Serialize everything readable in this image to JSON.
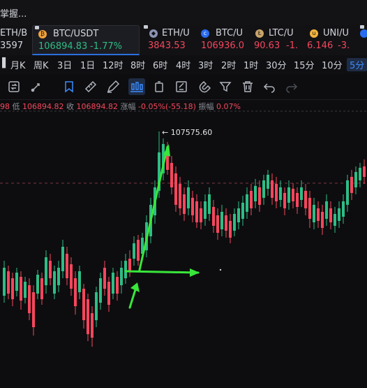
{
  "window": {
    "title": "掌握..."
  },
  "tickers": [
    {
      "symbol": "ETH/B",
      "price": "3597",
      "change": "",
      "dir": "up",
      "coin": ""
    },
    {
      "symbol": "BTC/USDT",
      "price": "106894.83",
      "change": "-1.77%",
      "dir": "up",
      "coin": "btc",
      "active": true
    },
    {
      "symbol": "ETH/U",
      "price": "3843.53",
      "change": "",
      "dir": "down",
      "coin": "eth"
    },
    {
      "symbol": "BTC/U",
      "price": "106936.0",
      "change": "",
      "dir": "down",
      "coin": "c"
    },
    {
      "symbol": "LTC/U",
      "price": "90.63",
      "change": "-1.",
      "dir": "down",
      "coin": "ltc"
    },
    {
      "symbol": "UNI/U",
      "price": "6.146",
      "change": "-3.",
      "dir": "down",
      "coin": "uni"
    },
    {
      "symbol": "",
      "price": "",
      "change": "",
      "dir": "down",
      "coin": "ada"
    }
  ],
  "periods": [
    "月K",
    "周K",
    "3日",
    "1日",
    "12时",
    "8时",
    "6时",
    "4时",
    "3时",
    "2时",
    "1时",
    "30分",
    "15分",
    "10分",
    "5分"
  ],
  "selected_period": "5分",
  "tools": [
    "refresh-icon",
    "cursor-icon",
    "bookmark-icon",
    "ruler-icon",
    "pen-icon",
    "candles-icon",
    "copy-icon",
    "note-icon",
    "magnet-icon",
    "filter-icon",
    "trash-icon",
    "undo-icon",
    "redo-icon"
  ],
  "infoline": {
    "prefix": "98",
    "low_label": "低",
    "low": "106894.82",
    "close_label": "收",
    "close": "106894.82",
    "change_label": "涨幅",
    "change": "-0.05%(-55.18)",
    "amp_label": "振幅",
    "amp": "0.07%"
  },
  "chart": {
    "high_label": "← 107575.60",
    "colors": {
      "up": "#2ebd85",
      "down": "#f6465d",
      "arrow": "#39e63a"
    }
  },
  "chart_data": {
    "type": "candlestick",
    "price_level_line": true,
    "high_marker": 107575.6
  }
}
